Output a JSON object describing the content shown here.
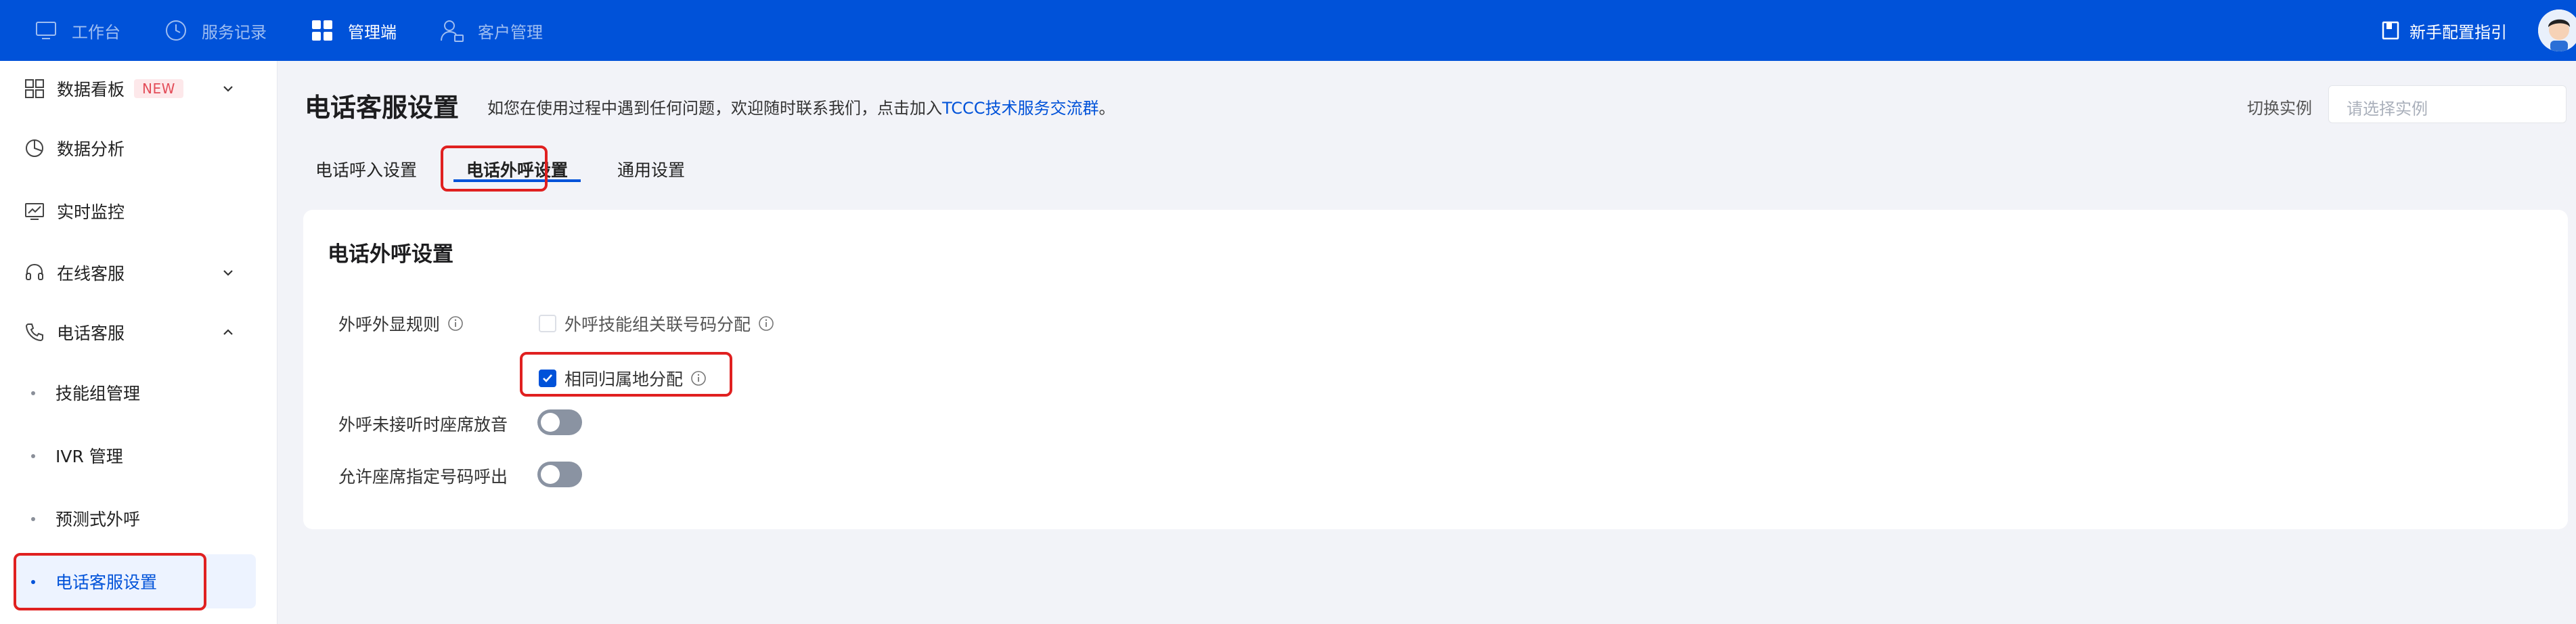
{
  "topnav": {
    "items": [
      {
        "label": "工作台",
        "icon": "monitor-icon",
        "active": false
      },
      {
        "label": "服务记录",
        "icon": "clock-icon",
        "active": false
      },
      {
        "label": "管理端",
        "icon": "grid-icon",
        "active": true
      },
      {
        "label": "客户管理",
        "icon": "user-manage-icon",
        "active": false
      }
    ],
    "guide_label": "新手配置指引",
    "colors": {
      "bar": "#0052d9",
      "text": "#ffffff"
    }
  },
  "sidebar": {
    "items": [
      {
        "label": "数据看板",
        "icon": "dashboard-icon",
        "badge": "NEW",
        "expand": "down"
      },
      {
        "label": "数据分析",
        "icon": "pie-chart-icon"
      },
      {
        "label": "实时监控",
        "icon": "monitor-chart-icon"
      },
      {
        "label": "在线客服",
        "icon": "headset-icon",
        "expand": "down"
      },
      {
        "label": "电话客服",
        "icon": "phone-icon",
        "expand": "up"
      }
    ],
    "sub_items": [
      {
        "label": "技能组管理",
        "active": false
      },
      {
        "label": "IVR 管理",
        "active": false
      },
      {
        "label": "预测式外呼",
        "active": false
      },
      {
        "label": "电话客服设置",
        "active": true
      }
    ]
  },
  "header": {
    "title": "电话客服设置",
    "tip_text": "如您在使用过程中遇到任何问题，欢迎随时联系我们，点击加入",
    "tip_link": "TCCC技术服务交流群",
    "tip_end": "。",
    "switch_label": "切换实例",
    "instance_placeholder": "请选择实例"
  },
  "tabs": [
    {
      "label": "电话呼入设置",
      "active": false
    },
    {
      "label": "电话外呼设置",
      "active": true
    },
    {
      "label": "通用设置",
      "active": false
    }
  ],
  "card": {
    "title": "电话外呼设置",
    "display_rule_label": "外呼外显规则",
    "option_skill_group": {
      "label": "外呼技能组关联号码分配",
      "checked": false
    },
    "option_same_region": {
      "label": "相同归属地分配",
      "checked": true
    },
    "unanswered_sound_label": "外呼未接听时座席放音",
    "unanswered_sound_on": false,
    "allow_specify_label": "允许座席指定号码呼出",
    "allow_specify_on": false
  },
  "colors": {
    "accent": "#0052d9",
    "highlight": "#e02020",
    "toggle_off": "#8a93a2"
  }
}
